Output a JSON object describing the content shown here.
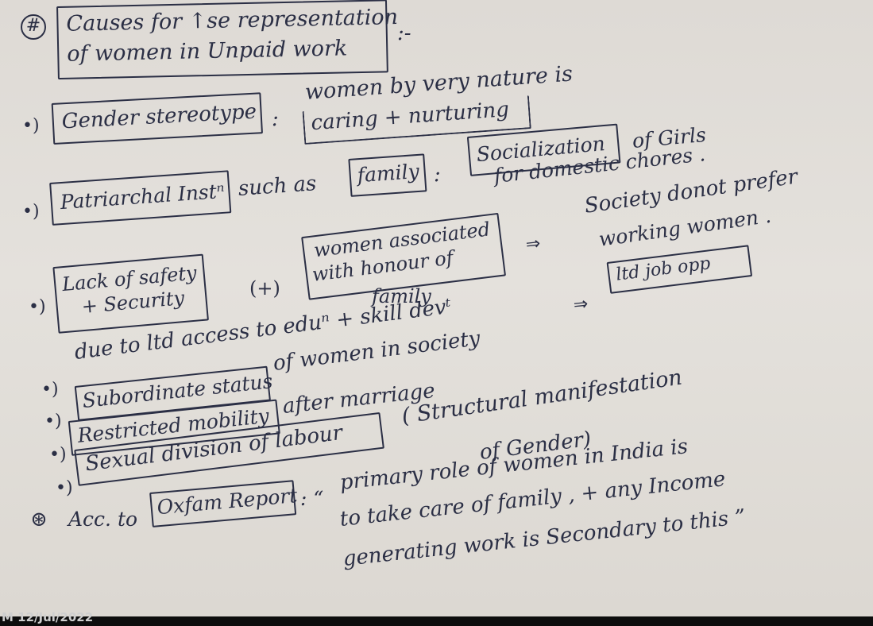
{
  "heading": {
    "symbol": "#",
    "line1": "Causes for ↑se representation",
    "line2": "of women in Unpaid work",
    "suffix": ":-"
  },
  "rows": {
    "gender": {
      "bullet": "•)",
      "box": "Gender stereotype",
      "colon": ":",
      "line1": "women by very nature is",
      "boxed": "caring + nurturing"
    },
    "patriarchal": {
      "bullet": "•)",
      "box": "Patriarchal Instⁿ",
      "mid": "such as",
      "box2": "family",
      "colon": ":",
      "box3": "Socialization",
      "tail": "of Girls",
      "line2": "for domestic chores ."
    },
    "safety": {
      "bullet": "•)",
      "box_line1": "Lack of safety",
      "box_line2": "+ Security",
      "plus": "(+)",
      "box2_line1": "women associated",
      "box2_line2": "with honour of",
      "under": "family",
      "arrow1": "⇒",
      "society1": "Society donot prefer",
      "society2": "working women .",
      "arrow2": "⇒",
      "boxed": "ltd job opp"
    },
    "due": {
      "bullet": "•)",
      "text": "due to ltd access to eduⁿ + skill devᵗ"
    },
    "subordinate": {
      "bullet": "•)",
      "box": "Subordinate status",
      "text": "of women in society"
    },
    "restricted": {
      "bullet": "•)",
      "box": "Restricted mobility",
      "text": "after marriage"
    },
    "sexual": {
      "bullet": "•)",
      "box": "Sexual division of labour",
      "text": "( Structural manifestation",
      "text2": "of Gender)"
    },
    "oxfam": {
      "symbol": "⊛",
      "prefix": "Acc. to",
      "box": "Oxfam Report",
      "colon": ": “",
      "line1": "primary role of women in India is",
      "line2": "to take care of family , + any Income",
      "line3": "generating work is Secondary to this ”"
    }
  },
  "footer": {
    "timestamp": "M 12/Jul/2022"
  },
  "colors": {
    "ink": "#2b2f45",
    "paper": "#e0ddd8"
  }
}
